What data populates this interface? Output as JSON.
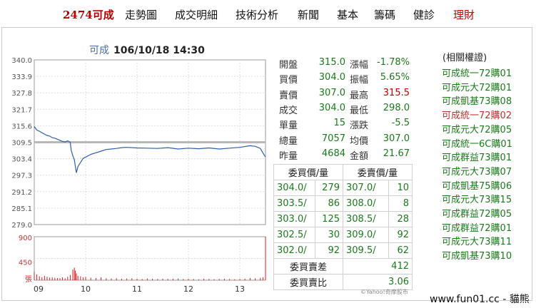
{
  "nav": [
    {
      "label": "2474可成",
      "style": "brand"
    },
    {
      "label": "走勢圖",
      "style": ""
    },
    {
      "label": "成交明細",
      "style": ""
    },
    {
      "label": "技術分析",
      "style": ""
    },
    {
      "label": "新聞",
      "style": ""
    },
    {
      "label": "基本",
      "style": ""
    },
    {
      "label": "籌碼",
      "style": ""
    },
    {
      "label": "健診",
      "style": ""
    },
    {
      "label": "理財",
      "style": "red"
    }
  ],
  "header": {
    "symbol": "可成",
    "datetime": "106/10/18 14:30"
  },
  "chart_data": {
    "type": "line",
    "price_ticks": [
      "340.0",
      "333.9",
      "327.8",
      "321.7",
      "315.6",
      "309.5",
      "303.4",
      "297.3",
      "291.2",
      "285.1",
      "279.0"
    ],
    "price_ylim": [
      279.0,
      340.0
    ],
    "reference_price": 309.5,
    "volume_ticks": [
      "900",
      "450",
      "張"
    ],
    "x_ticks": [
      "09",
      "10",
      "11",
      "12",
      "13"
    ],
    "price_series": [
      [
        9.0,
        315.3
      ],
      [
        9.05,
        314.0
      ],
      [
        9.1,
        313.6
      ],
      [
        9.15,
        313.0
      ],
      [
        9.2,
        312.5
      ],
      [
        9.25,
        312.0
      ],
      [
        9.3,
        311.8
      ],
      [
        9.35,
        311.2
      ],
      [
        9.4,
        311.0
      ],
      [
        9.45,
        310.6
      ],
      [
        9.5,
        310.2
      ],
      [
        9.55,
        309.8
      ],
      [
        9.6,
        309.6
      ],
      [
        9.65,
        310.0
      ],
      [
        9.7,
        309.5
      ],
      [
        9.72,
        306.5
      ],
      [
        9.75,
        304.5
      ],
      [
        9.78,
        303.0
      ],
      [
        9.8,
        300.5
      ],
      [
        9.82,
        298.2
      ],
      [
        9.85,
        300.5
      ],
      [
        9.9,
        302.0
      ],
      [
        9.95,
        303.5
      ],
      [
        10.0,
        304.0
      ],
      [
        10.1,
        305.0
      ],
      [
        10.2,
        305.6
      ],
      [
        10.3,
        306.2
      ],
      [
        10.4,
        306.8
      ],
      [
        10.5,
        307.0
      ],
      [
        10.6,
        307.2
      ],
      [
        10.7,
        307.5
      ],
      [
        10.8,
        307.6
      ],
      [
        11.0,
        307.4
      ],
      [
        11.2,
        307.3
      ],
      [
        11.4,
        307.2
      ],
      [
        11.6,
        307.5
      ],
      [
        11.8,
        307.0
      ],
      [
        12.0,
        307.3
      ],
      [
        12.2,
        307.1
      ],
      [
        12.4,
        307.4
      ],
      [
        12.6,
        307.0
      ],
      [
        12.8,
        307.3
      ],
      [
        13.0,
        307.6
      ],
      [
        13.2,
        308.2
      ],
      [
        13.3,
        308.0
      ],
      [
        13.4,
        307.2
      ],
      [
        13.45,
        305.5
      ],
      [
        13.5,
        304.0
      ]
    ],
    "volume_series": [
      [
        9.0,
        180
      ],
      [
        9.05,
        120
      ],
      [
        9.1,
        80
      ],
      [
        9.15,
        60
      ],
      [
        9.2,
        90
      ],
      [
        9.25,
        70
      ],
      [
        9.3,
        55
      ],
      [
        9.35,
        60
      ],
      [
        9.4,
        50
      ],
      [
        9.45,
        45
      ],
      [
        9.5,
        40
      ],
      [
        9.55,
        60
      ],
      [
        9.6,
        40
      ],
      [
        9.65,
        70
      ],
      [
        9.7,
        110
      ],
      [
        9.75,
        220
      ],
      [
        9.78,
        260
      ],
      [
        9.8,
        200
      ],
      [
        9.82,
        140
      ],
      [
        9.85,
        90
      ],
      [
        9.9,
        80
      ],
      [
        9.95,
        60
      ],
      [
        10.0,
        70
      ],
      [
        10.1,
        50
      ],
      [
        10.2,
        45
      ],
      [
        10.3,
        60
      ],
      [
        10.4,
        40
      ],
      [
        10.5,
        35
      ],
      [
        10.6,
        40
      ],
      [
        10.7,
        30
      ],
      [
        10.8,
        35
      ],
      [
        10.9,
        40
      ],
      [
        11.0,
        30
      ],
      [
        11.1,
        25
      ],
      [
        11.2,
        35
      ],
      [
        11.3,
        30
      ],
      [
        11.4,
        25
      ],
      [
        11.5,
        30
      ],
      [
        11.6,
        25
      ],
      [
        11.7,
        30
      ],
      [
        11.8,
        35
      ],
      [
        11.9,
        25
      ],
      [
        12.0,
        30
      ],
      [
        12.1,
        25
      ],
      [
        12.2,
        20
      ],
      [
        12.3,
        30
      ],
      [
        12.4,
        25
      ],
      [
        12.5,
        20
      ],
      [
        12.6,
        25
      ],
      [
        12.7,
        30
      ],
      [
        12.8,
        25
      ],
      [
        12.9,
        20
      ],
      [
        13.0,
        25
      ],
      [
        13.1,
        30
      ],
      [
        13.2,
        45
      ],
      [
        13.3,
        40
      ],
      [
        13.4,
        50
      ],
      [
        13.45,
        60
      ],
      [
        13.5,
        900
      ]
    ],
    "volume_ylim": [
      0,
      900
    ]
  },
  "stats": [
    {
      "l1": "開盤",
      "v1": "315.0",
      "c1": "g",
      "l2": "漲幅",
      "v2": "-1.78%",
      "c2": "g"
    },
    {
      "l1": "買價",
      "v1": "304.0",
      "c1": "g",
      "l2": "振幅",
      "v2": "5.65%",
      "c2": "g"
    },
    {
      "l1": "賣價",
      "v1": "307.0",
      "c1": "g",
      "l2": "最高",
      "v2": "315.5",
      "c2": "r"
    },
    {
      "l1": "成交",
      "v1": "304.0",
      "c1": "g",
      "l2": "最低",
      "v2": "298.0",
      "c2": "g"
    },
    {
      "l1": "單量",
      "v1": "15",
      "c1": "g",
      "l2": "漲跌",
      "v2": "-5.5",
      "c2": "g"
    },
    {
      "l1": "總量",
      "v1": "7057",
      "c1": "g",
      "l2": "均價",
      "v2": "307.0",
      "c2": "g"
    },
    {
      "l1": "昨量",
      "v1": "4684",
      "c1": "g",
      "l2": "金額",
      "v2": "21.67",
      "c2": "g"
    }
  ],
  "orderbook": {
    "bid_header": "委買價/量",
    "ask_header": "委賣價/量",
    "rows": [
      {
        "bp": "304.0/",
        "bv": "279",
        "ap": "307.0/",
        "av": "10"
      },
      {
        "bp": "303.5/",
        "bv": "86",
        "ap": "308.0/",
        "av": "8"
      },
      {
        "bp": "303.0/",
        "bv": "125",
        "ap": "308.5/",
        "av": "28"
      },
      {
        "bp": "302.5/",
        "bv": "30",
        "ap": "309.0/",
        "av": "92"
      },
      {
        "bp": "302.0/",
        "bv": "92",
        "ap": "309.5/",
        "av": "62"
      }
    ],
    "diff_label": "委買賣差",
    "diff_value": "412",
    "ratio_label": "委買賣比",
    "ratio_value": "3.06"
  },
  "related": {
    "title": "(相關權證)",
    "items": [
      {
        "label": "可成統一72購01",
        "style": ""
      },
      {
        "label": "可成元大72購01",
        "style": ""
      },
      {
        "label": "可成凱基73購08",
        "style": ""
      },
      {
        "label": "可成統一72購02",
        "style": "red"
      },
      {
        "label": "可成元大72購05",
        "style": ""
      },
      {
        "label": "可成統一6C購01",
        "style": ""
      },
      {
        "label": "可成群益73購01",
        "style": ""
      },
      {
        "label": "可成元大73購07",
        "style": ""
      },
      {
        "label": "可成凱基75購06",
        "style": ""
      },
      {
        "label": "可成元大73購15",
        "style": ""
      },
      {
        "label": "可成群益72購05",
        "style": ""
      },
      {
        "label": "可成群益72購01",
        "style": ""
      },
      {
        "label": "可成元大73購11",
        "style": ""
      },
      {
        "label": "可成凱基73購10",
        "style": ""
      }
    ]
  },
  "yahoo_credit": "©Yahoo!奇摩股市",
  "footer": "www.fun01.cc - 貓熊",
  "colors": {
    "brand": "#b30000",
    "up": "#c00000",
    "down": "#1b7a1b",
    "line": "#2e5fa8",
    "volume": "#d02020",
    "ref": "#b8b8b8"
  }
}
